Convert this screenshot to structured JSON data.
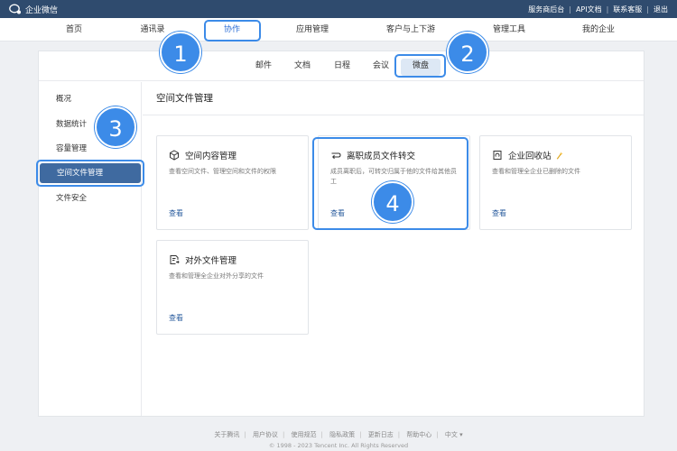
{
  "brand": {
    "name": "企业微信"
  },
  "toplinks": [
    "服务商后台",
    "API文档",
    "联系客服",
    "退出"
  ],
  "mainnav": [
    {
      "label": "首页"
    },
    {
      "label": "通讯录"
    },
    {
      "label": "协作"
    },
    {
      "label": "应用管理"
    },
    {
      "label": "客户与上下游"
    },
    {
      "label": "管理工具"
    },
    {
      "label": "我的企业"
    }
  ],
  "subtabs": [
    "邮件",
    "文档",
    "日程",
    "会议",
    "微盘"
  ],
  "sidebar": [
    "概况",
    "数据统计",
    "容量管理",
    "空间文件管理",
    "文件安全"
  ],
  "content": {
    "title": "空间文件管理"
  },
  "cards": [
    {
      "title": "空间内容管理",
      "desc": "查看空间文件、管理空间和文件的权限",
      "link": "查看",
      "icon": "cube-icon"
    },
    {
      "title": "离职成员文件转交",
      "desc": "成员离职后，可转交归属于他的文件给其他员工",
      "link": "查看",
      "icon": "transfer-icon"
    },
    {
      "title": "企业回收站",
      "desc": "查看和管理全企业已删除的文件",
      "link": "查看",
      "icon": "recycle-bin-icon"
    },
    {
      "title": "对外文件管理",
      "desc": "查看和管理全企业对外分享的文件",
      "link": "查看",
      "icon": "external-file-icon"
    }
  ],
  "badges": [
    "1",
    "2",
    "3",
    "4"
  ],
  "footer": {
    "links": [
      "关于腾讯",
      "用户协议",
      "使用规范",
      "隐私政策",
      "更新日志",
      "帮助中心",
      "中文 ▾"
    ],
    "copyright": "© 1998 - 2023 Tencent Inc. All Rights Reserved"
  },
  "colors": {
    "topbar": "#2f4b6e",
    "accent": "#3c8be8",
    "sidebar_active": "#3f6aa0"
  }
}
